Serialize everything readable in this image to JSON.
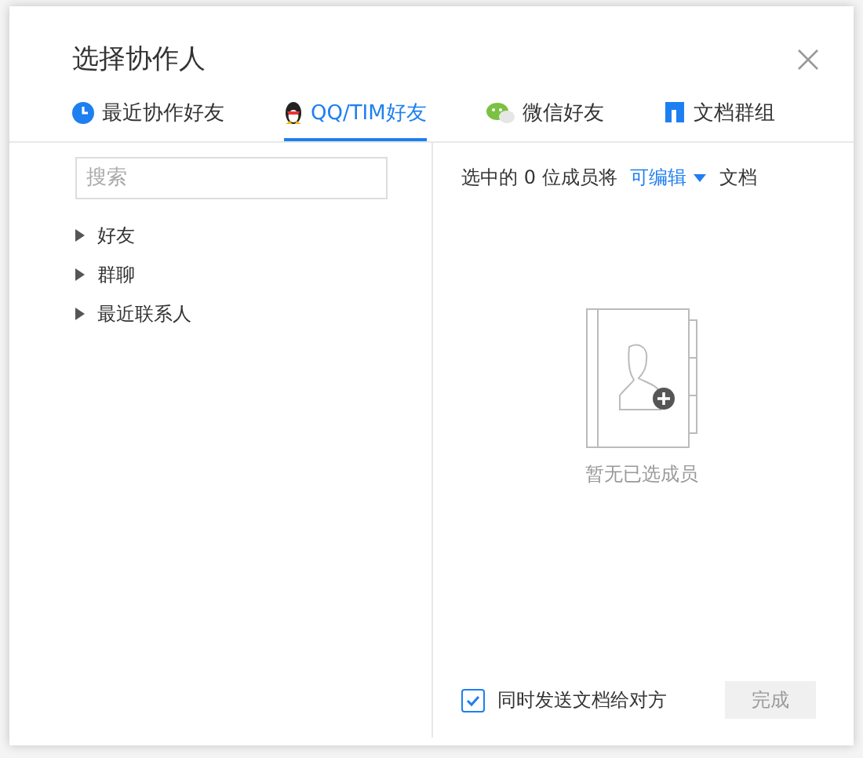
{
  "dialog": {
    "title": "选择协作人"
  },
  "tabs": [
    {
      "label": "最近协作好友",
      "kind": "clock",
      "selected": false
    },
    {
      "label": "QQ/TIM好友",
      "kind": "penguin",
      "selected": true
    },
    {
      "label": "微信好友",
      "kind": "chat",
      "selected": false
    },
    {
      "label": "文档群组",
      "kind": "group",
      "selected": false
    }
  ],
  "search": {
    "placeholder": "搜索"
  },
  "tree": [
    {
      "label": "好友",
      "expanded": false
    },
    {
      "label": "群聊",
      "expanded": false
    },
    {
      "label": "最近联系人",
      "expanded": false
    }
  ],
  "selection": {
    "prefix": "选中的 0 位成员将",
    "permission": "可编辑",
    "suffix": "文档"
  },
  "empty_text": "暂无已选成员",
  "send_copy": {
    "label": "同时发送文档给对方",
    "checked": true
  },
  "done_button": {
    "label": "完成",
    "disabled": true
  }
}
